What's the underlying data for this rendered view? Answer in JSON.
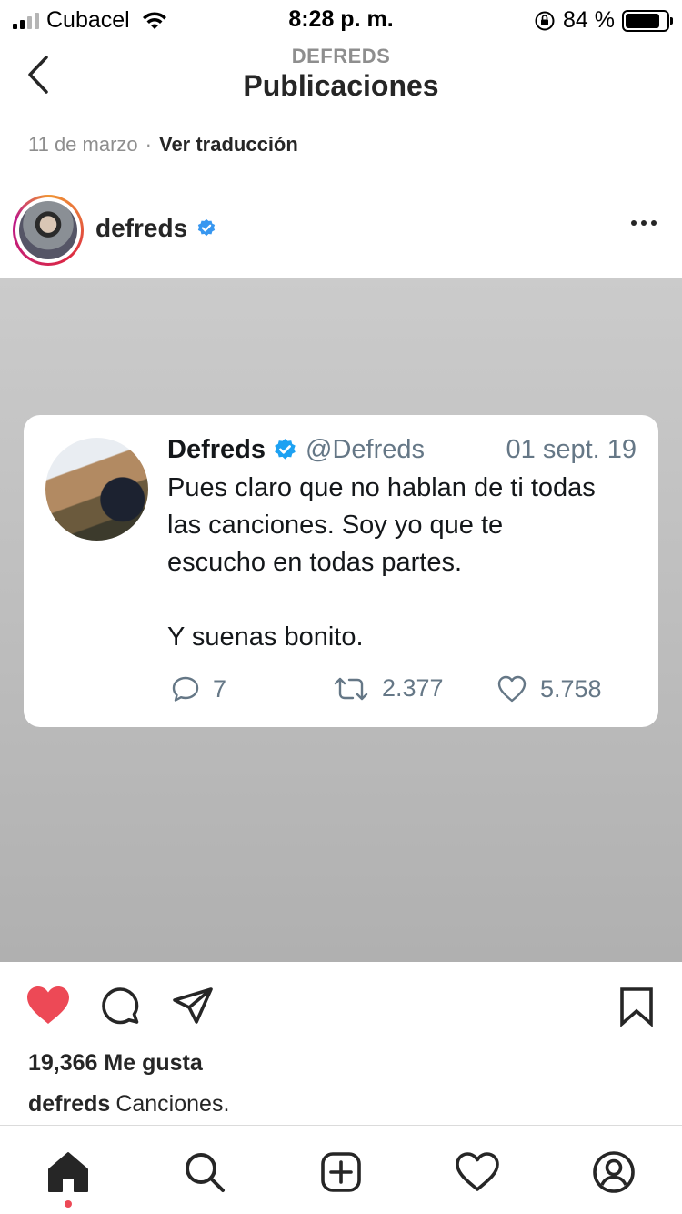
{
  "status_bar": {
    "carrier": "Cubacel",
    "time": "8:28 p. m.",
    "battery_percent": "84 %",
    "battery_level": 0.84
  },
  "header": {
    "subtitle": "DEFREDS",
    "title": "Publicaciones"
  },
  "post": {
    "date": "11 de marzo",
    "separator": "·",
    "translate_label": "Ver traducción",
    "username": "defreds",
    "verified": true,
    "likes": "19,366 Me gusta",
    "caption_user": "defreds",
    "caption_text": "Canciones."
  },
  "tweet": {
    "name": "Defreds",
    "handle": "@Defreds",
    "date": "01 sept. 19",
    "text": "Pues claro que no hablan de ti todas\nlas canciones. Soy yo que te\nescucho en todas partes.\n\nY suenas bonito.",
    "replies": "7",
    "retweets": "2.377",
    "likes": "5.758"
  },
  "colors": {
    "like_red": "#ed4956",
    "verified_blue": "#3897f0",
    "twitter_blue": "#1da1f2",
    "muted_gray": "#8e8e8e"
  },
  "icons": {
    "back": "chevron-left-icon",
    "more": "ellipsis-icon",
    "like": "heart-filled-icon",
    "comment": "comment-bubble-icon",
    "share": "paper-plane-icon",
    "save": "bookmark-icon",
    "tabs": [
      "home-icon",
      "search-icon",
      "plus-square-icon",
      "heart-outline-icon",
      "profile-icon"
    ]
  }
}
